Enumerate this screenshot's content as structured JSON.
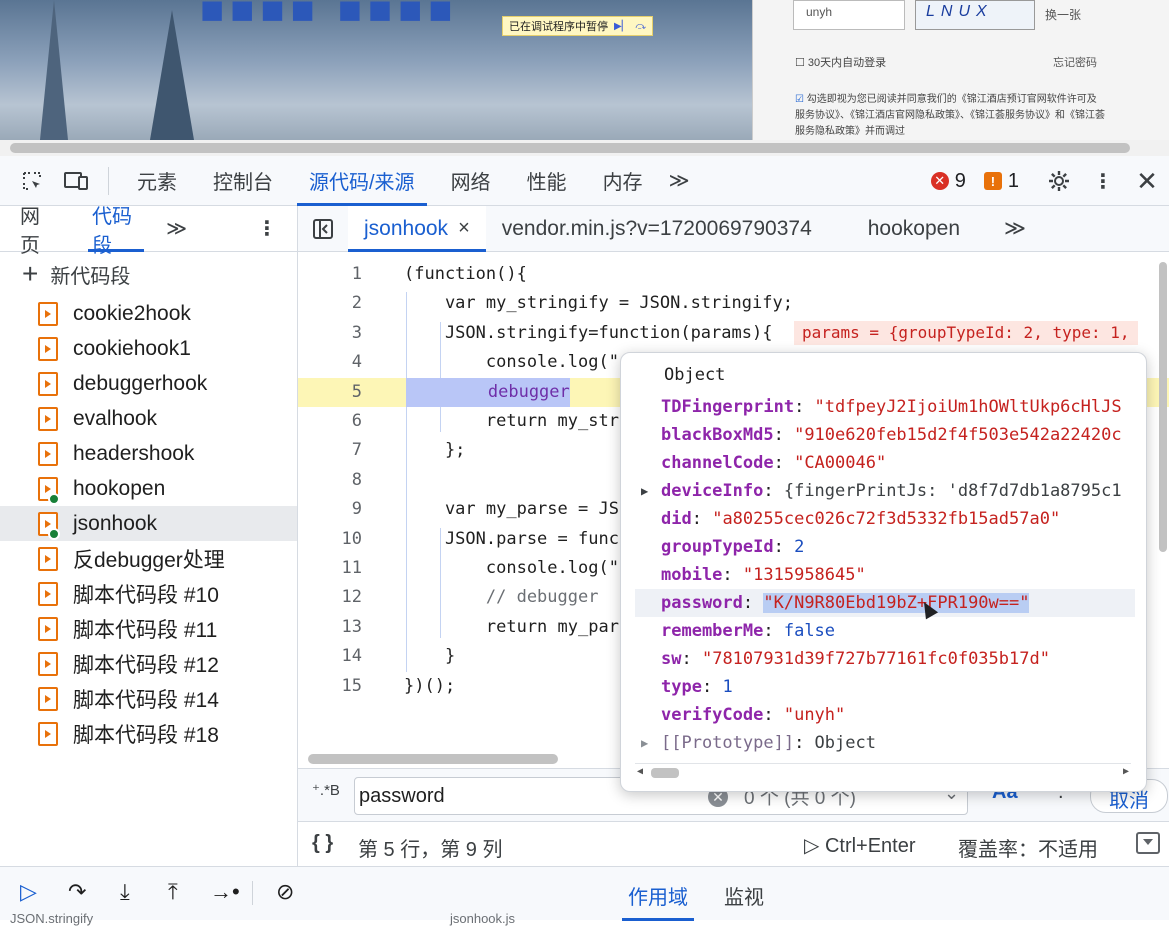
{
  "site": {
    "paused_text": "已在调试程序中暂停",
    "captcha_value": "unyh",
    "captcha_image_text": "LNUX",
    "captcha_refresh": "换一张",
    "remember_30days": "30天内自动登录",
    "forgot_password": "忘记密码",
    "agree_text": "勾选即视为您已阅读并同意我们的《锦江酒店预订官网软件许可及服务协议》、《锦江酒店官网隐私政策》、《锦江荟服务协议》和《锦江荟服务隐私政策》并而调过"
  },
  "toolbar": {
    "tabs": [
      "元素",
      "控制台",
      "源代码/来源",
      "网络",
      "性能",
      "内存"
    ],
    "more": "≫",
    "error_count": "9",
    "warning_count": "1"
  },
  "navigator": {
    "tabs": [
      "网页",
      "代码段"
    ],
    "more": "≫",
    "menu": "⋮",
    "new_snippet": "新代码段",
    "snippets": [
      {
        "name": "cookie2hook",
        "has_dot": false
      },
      {
        "name": "cookiehook1",
        "has_dot": false
      },
      {
        "name": "debuggerhook",
        "has_dot": false
      },
      {
        "name": "evalhook",
        "has_dot": false
      },
      {
        "name": "headershook",
        "has_dot": false
      },
      {
        "name": "hookopen",
        "has_dot": true
      },
      {
        "name": "jsonhook",
        "has_dot": true
      },
      {
        "name": "反debugger处理",
        "has_dot": false
      },
      {
        "name": "脚本代码段 #10",
        "has_dot": false
      },
      {
        "name": "脚本代码段 #11",
        "has_dot": false
      },
      {
        "name": "脚本代码段 #12",
        "has_dot": false
      },
      {
        "name": "脚本代码段 #14",
        "has_dot": false
      },
      {
        "name": "脚本代码段 #18",
        "has_dot": false
      }
    ]
  },
  "editor": {
    "tabs": [
      "jsonhook",
      "vendor.min.js?v=1720069790374",
      "hookopen"
    ],
    "close": "×",
    "more": "≫",
    "inline_value": "params = {groupTypeId: 2, type: 1,",
    "lines": [
      {
        "n": "1",
        "t": "(function(){"
      },
      {
        "n": "2",
        "t": "    var my_stringify = JSON.stringify;"
      },
      {
        "n": "3",
        "t": "    JSON.stringify=function(params){"
      },
      {
        "n": "4",
        "t": "        console.log(\""
      },
      {
        "n": "5",
        "t": "        debugger"
      },
      {
        "n": "6",
        "t": "        return my_str"
      },
      {
        "n": "7",
        "t": "    };"
      },
      {
        "n": "8",
        "t": ""
      },
      {
        "n": "9",
        "t": "    var my_parse = JS"
      },
      {
        "n": "10",
        "t": "    JSON.parse = func"
      },
      {
        "n": "11",
        "t": "        console.log(\""
      },
      {
        "n": "12",
        "t": "        // debugger"
      },
      {
        "n": "13",
        "t": "        return my_par"
      },
      {
        "n": "14",
        "t": "    }"
      },
      {
        "n": "15",
        "t": "})();"
      }
    ]
  },
  "popover": {
    "title": "Object",
    "props": [
      {
        "key": "TDFingerprint",
        "value": "\"tdfpeyJ2IjoiUm1hOWltUkp6cHlJS",
        "kind": "str"
      },
      {
        "key": "blackBoxMd5",
        "value": "\"910e620feb15d2f4f503e542a22420c",
        "kind": "str"
      },
      {
        "key": "channelCode",
        "value": "\"CA00046\"",
        "kind": "str"
      },
      {
        "key": "deviceInfo",
        "value": "{fingerPrintJs: 'd8f7d7db1a8795c1",
        "kind": "obj"
      },
      {
        "key": "did",
        "value": "\"a80255cec026c72f3d5332fb15ad57a0\"",
        "kind": "str"
      },
      {
        "key": "groupTypeId",
        "value": "2",
        "kind": "num"
      },
      {
        "key": "mobile",
        "value": "\"1315958645\"",
        "kind": "str"
      },
      {
        "key": "password",
        "value": "\"K/N9R80Ebd19bZ+FPR190w==\"",
        "kind": "str"
      },
      {
        "key": "rememberMe",
        "value": "false",
        "kind": "num"
      },
      {
        "key": "sw",
        "value": "\"78107931d39f727b77161fc0f035b17d\"",
        "kind": "str"
      },
      {
        "key": "type",
        "value": "1",
        "kind": "num"
      },
      {
        "key": "verifyCode",
        "value": "\"unyh\"",
        "kind": "str"
      },
      {
        "key": "[[Prototype]]",
        "value": "Object",
        "kind": "proto"
      }
    ]
  },
  "search": {
    "value": "password",
    "regex_label": "⁺.*B",
    "count": "0 个 (共 0 个)",
    "case_label": "Aa",
    "cancel": "取消"
  },
  "status": {
    "braces": "{ }",
    "position": "第 5 行，第 9 列",
    "run": "Ctrl+Enter",
    "coverage": "覆盖率：不适用"
  },
  "debug": {
    "scope": "作用域",
    "watch": "监视",
    "peek_left": "JSON.stringify",
    "peek_right": "jsonhook.js"
  }
}
